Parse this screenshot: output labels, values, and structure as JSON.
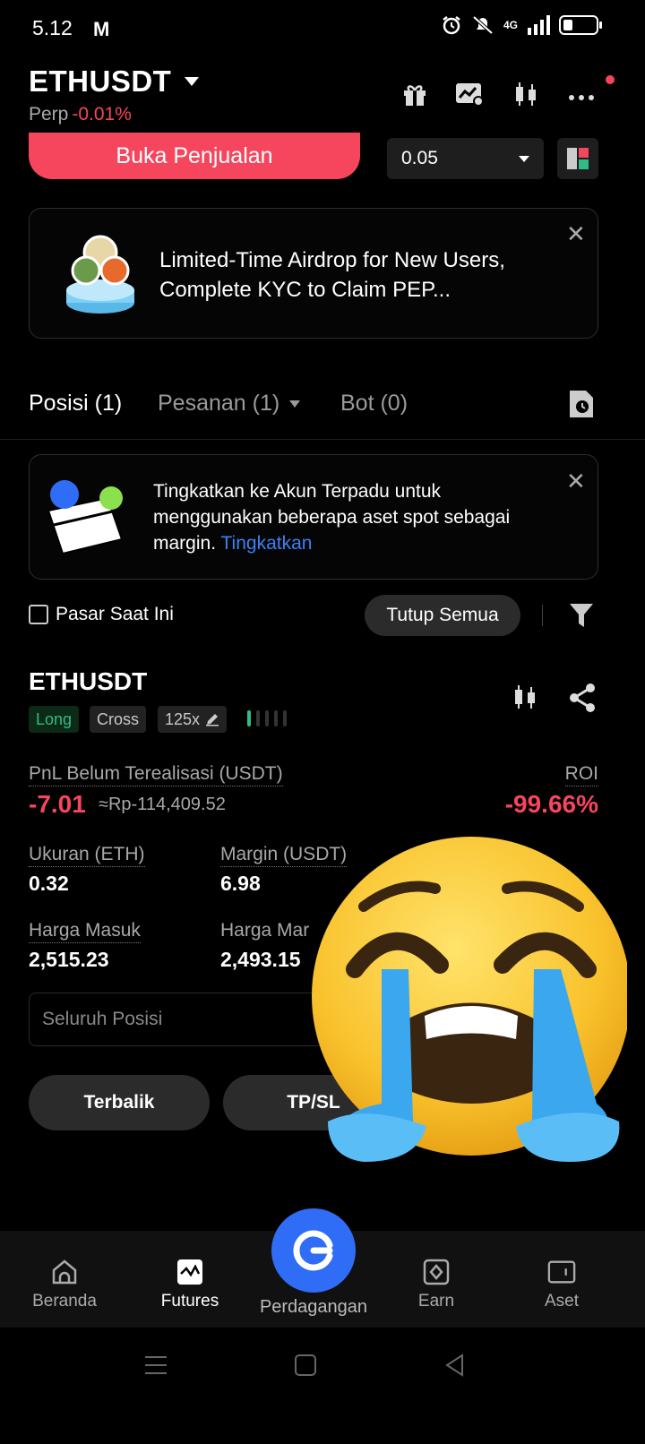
{
  "status_bar": {
    "time": "5.12",
    "gmail": "M",
    "network": "4G"
  },
  "header": {
    "symbol": "ETHUSDT",
    "market_type": "Perp",
    "change": "-0.01%"
  },
  "order": {
    "sell_label": "Buka Penjualan",
    "quantity": "0.05"
  },
  "airdrop_banner": {
    "text": "Limited-Time Airdrop for New Users, Complete KYC to Claim PEP..."
  },
  "tabs": [
    {
      "label": "Posisi (1)"
    },
    {
      "label": "Pesanan (1)"
    },
    {
      "label": "Bot (0)"
    }
  ],
  "upgrade_banner": {
    "text": "Tingkatkan ke Akun Terpadu untuk menggunakan beberapa aset spot sebagai margin.",
    "link": "Tingkatkan"
  },
  "filters": {
    "current_market_label": "Pasar Saat Ini",
    "close_all_label": "Tutup Semua"
  },
  "position": {
    "symbol": "ETHUSDT",
    "side": "Long",
    "margin_mode": "Cross",
    "leverage": "125x",
    "risk_level_active": 1,
    "pnl_label": "PnL Belum Terealisasi (USDT)",
    "pnl_value": "-7.01",
    "pnl_idr": "≈Rp-114,409.52",
    "roi_label": "ROI",
    "roi_value": "-99.66%",
    "size_label": "Ukuran (ETH)",
    "size_value": "0.32",
    "margin_label": "Margin (USDT)",
    "margin_value": "6.98",
    "entry_label": "Harga Masuk",
    "entry_value": "2,515.23",
    "mark_label": "Harga Mar",
    "mark_value": "2,493.15",
    "full_position_placeholder": "Seluruh Posisi",
    "reverse_label": "Terbalik",
    "tpsl_label": "TP/SL"
  },
  "bottom_nav": [
    {
      "label": "Beranda",
      "icon": "home-icon"
    },
    {
      "label": "Futures",
      "icon": "futures-icon"
    },
    {
      "label": "Perdagangan",
      "icon": "trade-icon"
    },
    {
      "label": "Earn",
      "icon": "earn-icon"
    },
    {
      "label": "Aset",
      "icon": "wallet-icon"
    }
  ],
  "colors": {
    "sell": "#f6465d",
    "long": "#2ebd85",
    "link": "#3b82f6",
    "trade": "#2f6df6"
  },
  "overlay": {
    "emoji": "loudly-crying-face"
  }
}
